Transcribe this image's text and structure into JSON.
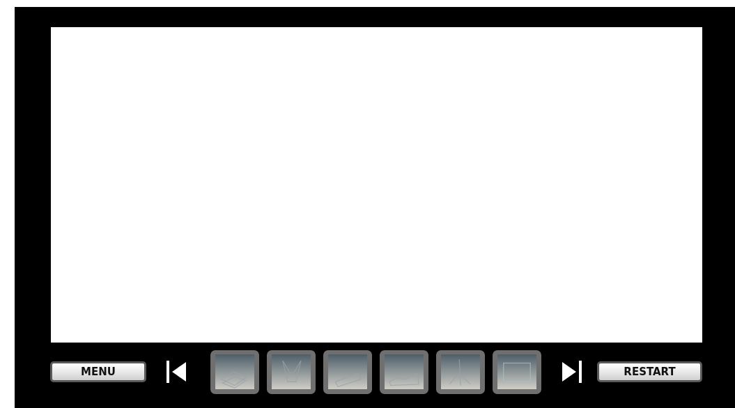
{
  "menu_button": {
    "label": "MENU"
  },
  "restart_button": {
    "label": "RESTART"
  }
}
